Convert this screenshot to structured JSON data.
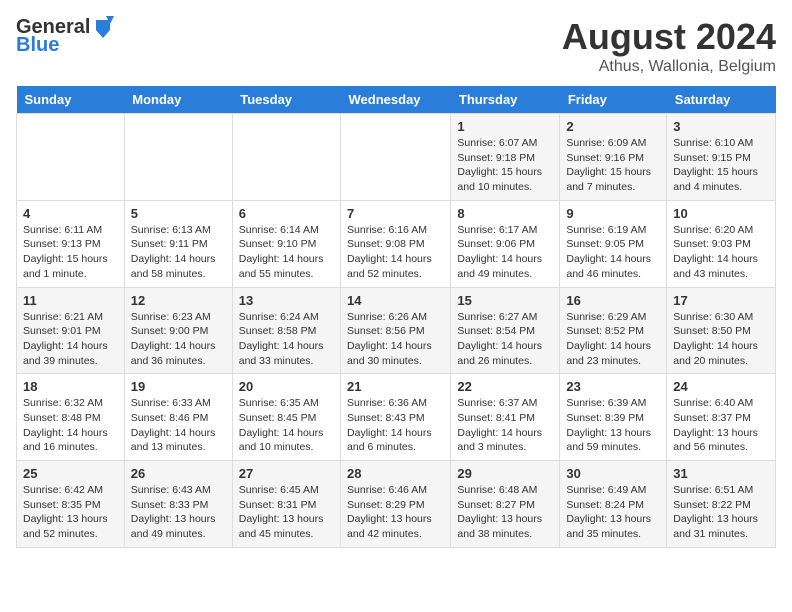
{
  "header": {
    "logo_line1": "General",
    "logo_line2": "Blue",
    "title": "August 2024",
    "subtitle": "Athus, Wallonia, Belgium"
  },
  "days_of_week": [
    "Sunday",
    "Monday",
    "Tuesday",
    "Wednesday",
    "Thursday",
    "Friday",
    "Saturday"
  ],
  "weeks": [
    [
      {
        "day": "",
        "info": ""
      },
      {
        "day": "",
        "info": ""
      },
      {
        "day": "",
        "info": ""
      },
      {
        "day": "",
        "info": ""
      },
      {
        "day": "1",
        "info": "Sunrise: 6:07 AM\nSunset: 9:18 PM\nDaylight: 15 hours\nand 10 minutes."
      },
      {
        "day": "2",
        "info": "Sunrise: 6:09 AM\nSunset: 9:16 PM\nDaylight: 15 hours\nand 7 minutes."
      },
      {
        "day": "3",
        "info": "Sunrise: 6:10 AM\nSunset: 9:15 PM\nDaylight: 15 hours\nand 4 minutes."
      }
    ],
    [
      {
        "day": "4",
        "info": "Sunrise: 6:11 AM\nSunset: 9:13 PM\nDaylight: 15 hours\nand 1 minute."
      },
      {
        "day": "5",
        "info": "Sunrise: 6:13 AM\nSunset: 9:11 PM\nDaylight: 14 hours\nand 58 minutes."
      },
      {
        "day": "6",
        "info": "Sunrise: 6:14 AM\nSunset: 9:10 PM\nDaylight: 14 hours\nand 55 minutes."
      },
      {
        "day": "7",
        "info": "Sunrise: 6:16 AM\nSunset: 9:08 PM\nDaylight: 14 hours\nand 52 minutes."
      },
      {
        "day": "8",
        "info": "Sunrise: 6:17 AM\nSunset: 9:06 PM\nDaylight: 14 hours\nand 49 minutes."
      },
      {
        "day": "9",
        "info": "Sunrise: 6:19 AM\nSunset: 9:05 PM\nDaylight: 14 hours\nand 46 minutes."
      },
      {
        "day": "10",
        "info": "Sunrise: 6:20 AM\nSunset: 9:03 PM\nDaylight: 14 hours\nand 43 minutes."
      }
    ],
    [
      {
        "day": "11",
        "info": "Sunrise: 6:21 AM\nSunset: 9:01 PM\nDaylight: 14 hours\nand 39 minutes."
      },
      {
        "day": "12",
        "info": "Sunrise: 6:23 AM\nSunset: 9:00 PM\nDaylight: 14 hours\nand 36 minutes."
      },
      {
        "day": "13",
        "info": "Sunrise: 6:24 AM\nSunset: 8:58 PM\nDaylight: 14 hours\nand 33 minutes."
      },
      {
        "day": "14",
        "info": "Sunrise: 6:26 AM\nSunset: 8:56 PM\nDaylight: 14 hours\nand 30 minutes."
      },
      {
        "day": "15",
        "info": "Sunrise: 6:27 AM\nSunset: 8:54 PM\nDaylight: 14 hours\nand 26 minutes."
      },
      {
        "day": "16",
        "info": "Sunrise: 6:29 AM\nSunset: 8:52 PM\nDaylight: 14 hours\nand 23 minutes."
      },
      {
        "day": "17",
        "info": "Sunrise: 6:30 AM\nSunset: 8:50 PM\nDaylight: 14 hours\nand 20 minutes."
      }
    ],
    [
      {
        "day": "18",
        "info": "Sunrise: 6:32 AM\nSunset: 8:48 PM\nDaylight: 14 hours\nand 16 minutes."
      },
      {
        "day": "19",
        "info": "Sunrise: 6:33 AM\nSunset: 8:46 PM\nDaylight: 14 hours\nand 13 minutes."
      },
      {
        "day": "20",
        "info": "Sunrise: 6:35 AM\nSunset: 8:45 PM\nDaylight: 14 hours\nand 10 minutes."
      },
      {
        "day": "21",
        "info": "Sunrise: 6:36 AM\nSunset: 8:43 PM\nDaylight: 14 hours\nand 6 minutes."
      },
      {
        "day": "22",
        "info": "Sunrise: 6:37 AM\nSunset: 8:41 PM\nDaylight: 14 hours\nand 3 minutes."
      },
      {
        "day": "23",
        "info": "Sunrise: 6:39 AM\nSunset: 8:39 PM\nDaylight: 13 hours\nand 59 minutes."
      },
      {
        "day": "24",
        "info": "Sunrise: 6:40 AM\nSunset: 8:37 PM\nDaylight: 13 hours\nand 56 minutes."
      }
    ],
    [
      {
        "day": "25",
        "info": "Sunrise: 6:42 AM\nSunset: 8:35 PM\nDaylight: 13 hours\nand 52 minutes."
      },
      {
        "day": "26",
        "info": "Sunrise: 6:43 AM\nSunset: 8:33 PM\nDaylight: 13 hours\nand 49 minutes."
      },
      {
        "day": "27",
        "info": "Sunrise: 6:45 AM\nSunset: 8:31 PM\nDaylight: 13 hours\nand 45 minutes."
      },
      {
        "day": "28",
        "info": "Sunrise: 6:46 AM\nSunset: 8:29 PM\nDaylight: 13 hours\nand 42 minutes."
      },
      {
        "day": "29",
        "info": "Sunrise: 6:48 AM\nSunset: 8:27 PM\nDaylight: 13 hours\nand 38 minutes."
      },
      {
        "day": "30",
        "info": "Sunrise: 6:49 AM\nSunset: 8:24 PM\nDaylight: 13 hours\nand 35 minutes."
      },
      {
        "day": "31",
        "info": "Sunrise: 6:51 AM\nSunset: 8:22 PM\nDaylight: 13 hours\nand 31 minutes."
      }
    ]
  ]
}
